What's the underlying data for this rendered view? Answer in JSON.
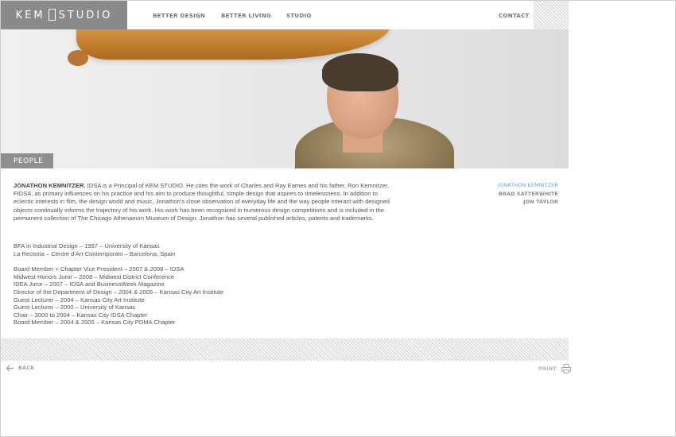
{
  "header": {
    "logo_left": "KEM",
    "logo_right": "STUDIO",
    "nav": [
      "BETTER DESIGN",
      "BETTER LIVING",
      "STUDIO",
      "CONTACT"
    ]
  },
  "section_tab": "PEOPLE",
  "bio": {
    "name": "JONATHON KEMNITZER",
    "text": ", IDSA is a Principal of KEM STUDIO. He cites the work of Charles and Ray Eames and his father, Ron Kemnitzer, FIDSA, as primary influences on his practice and his aim to produce thoughtful, simple design that aspires to timelessness. In addition to eclectic interests in film, the design world and music, Jonathon's close observation of everyday life and the way people interact with designed objects continually informs the trajectory of his work. His work has been recognized in numerous design competitions and is included in the permanent collection of The Chicago Athenaeum Museum of Design. Jonathon has several published articles, patents and trademarks."
  },
  "education": [
    "BFA in Industrial Design – 1997 – University of Kansas",
    "La Rectoria – Centre d'Art Contemporani – Barcelona, Spain"
  ],
  "experience": [
    "Board Member + Chapter Vice President – 2007 & 2008 – IDSA",
    "Midwest Honors Juror – 2008 – Midwest District Conference",
    "IDEA Juror – 2007 – IDSA and BusinessWeek Magazine",
    "Director of the Department of Design – 2004 & 2005 – Kansas City Art Institute",
    "Guest Lecturer – 2004 – Kansas City Art Institute",
    "Guest Lecturer – 2000 – University of Kansas",
    "Chair – 2000 to 2004 – Kansas City IDSA Chapter",
    "Board Member – 2004 & 2005 – Kansas City PDMA Chapter"
  ],
  "people": [
    {
      "name": "JONATHON KEMNITZER",
      "active": true
    },
    {
      "name": "BRAD SATTERWHITE",
      "active": false
    },
    {
      "name": "JON TAYLOR",
      "active": false
    }
  ],
  "footer": {
    "back_label": "BACK",
    "print_label": "PRINT",
    "back_icon": "arrow-left-icon",
    "print_icon": "printer-icon"
  },
  "colors": {
    "logo_bg": "#8a8a8a",
    "active_link": "#6ca3cf",
    "tab_bg": "#8f8f8f"
  }
}
